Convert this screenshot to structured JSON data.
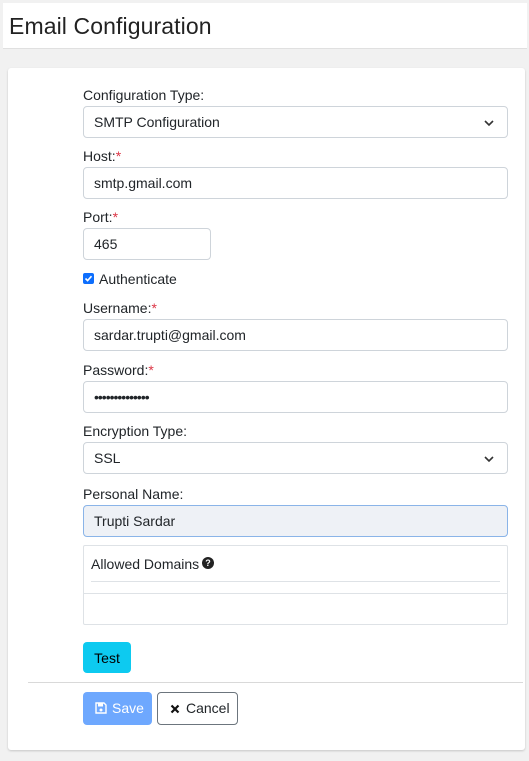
{
  "page": {
    "title": "Email Configuration"
  },
  "form": {
    "configuration_type": {
      "label": "Configuration Type:",
      "value": "SMTP Configuration"
    },
    "host": {
      "label": "Host:",
      "required_mark": "*",
      "value": "smtp.gmail.com"
    },
    "port": {
      "label": "Port:",
      "required_mark": "*",
      "value": "465"
    },
    "authenticate": {
      "label": "Authenticate",
      "checked": true
    },
    "username": {
      "label": "Username:",
      "required_mark": "*",
      "value": "sardar.trupti@gmail.com"
    },
    "password": {
      "label": "Password:",
      "required_mark": "*",
      "value": "••••••••••••••"
    },
    "encryption_type": {
      "label": "Encryption Type:",
      "value": "SSL"
    },
    "personal_name": {
      "label": "Personal Name:",
      "value": "Trupti Sardar"
    },
    "allowed_domains": {
      "label": "Allowed Domains",
      "help_icon": "question-circle-icon"
    }
  },
  "buttons": {
    "test": "Test",
    "save": "Save",
    "cancel": "Cancel"
  },
  "colors": {
    "required": "#dc3545",
    "test_button": "#0dcaf0",
    "save_button": "#6ea8fe",
    "checkbox": "#0d6efd"
  }
}
